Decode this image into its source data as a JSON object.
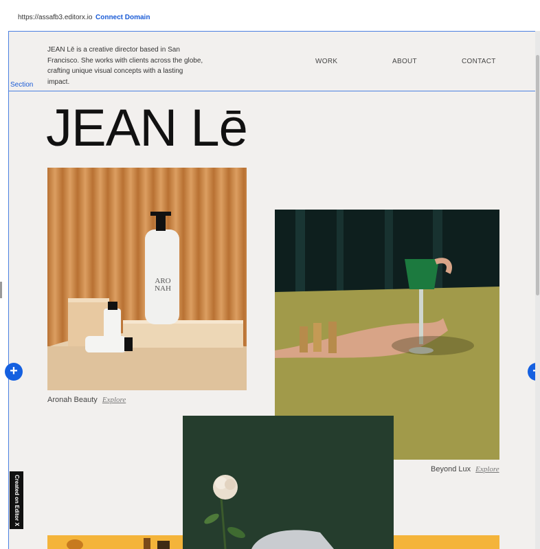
{
  "browser": {
    "url": "https://assafb3.editorx.io",
    "connect_domain": "Connect Domain"
  },
  "header": {
    "section_label": "Section",
    "bio": "JEAN Lē is a creative director based in San Francisco. She works with clients across the globe, crafting unique visual concepts with a lasting impact.",
    "nav": [
      "WORK",
      "ABOUT",
      "CONTACT"
    ]
  },
  "logo": "JEAN Lē",
  "projects": [
    {
      "title": "Aronah Beauty",
      "link": "Explore"
    },
    {
      "title": "Beyond Lux",
      "link": "Explore"
    }
  ],
  "product_label": "ARO NAH",
  "editor": {
    "badge": "Created on Editor X",
    "add_icon": "plus-icon"
  }
}
